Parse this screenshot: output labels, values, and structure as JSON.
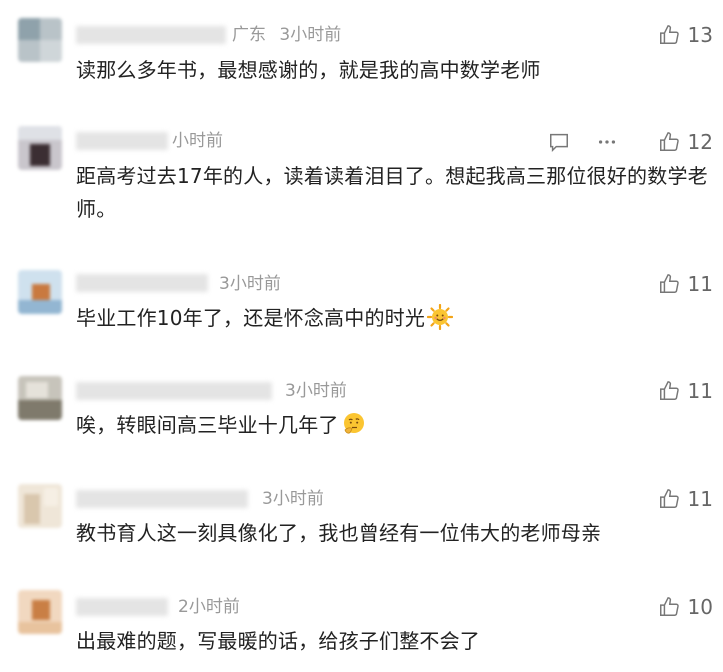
{
  "comments": [
    {
      "location": "广东",
      "time": "3小时前",
      "text": "读那么多年书，最想感谢的，就是我的高中数学老师",
      "likes": "13"
    },
    {
      "location": "",
      "time": "小时前",
      "text": "距高考过去17年的人，读着读着泪目了。想起我高三那位很好的数学老师。",
      "likes": "12"
    },
    {
      "location": "",
      "time": "3小时前",
      "text": "毕业工作10年了，还是怀念高中的时光",
      "likes": "11",
      "emoji": "sun-face-emoji"
    },
    {
      "location": "",
      "time": "3小时前",
      "text": "唉，转眼间高三毕业十几年了",
      "likes": "11",
      "emoji": "thinking-face-emoji"
    },
    {
      "location": "",
      "time": "3小时前",
      "text": "教书育人这一刻具像化了，我也曾经有一位伟大的老师母亲",
      "likes": "11"
    },
    {
      "location": "",
      "time": "2小时前",
      "text": "出最难的题，写最暖的话，给孩子们整不会了",
      "likes": "10"
    }
  ],
  "icons": {
    "like": "thumb-up-icon",
    "reply": "comment-bubble-icon",
    "more": "more-dots-icon"
  },
  "colors": {
    "text": "#222222",
    "meta": "#999999",
    "count": "#666666"
  }
}
